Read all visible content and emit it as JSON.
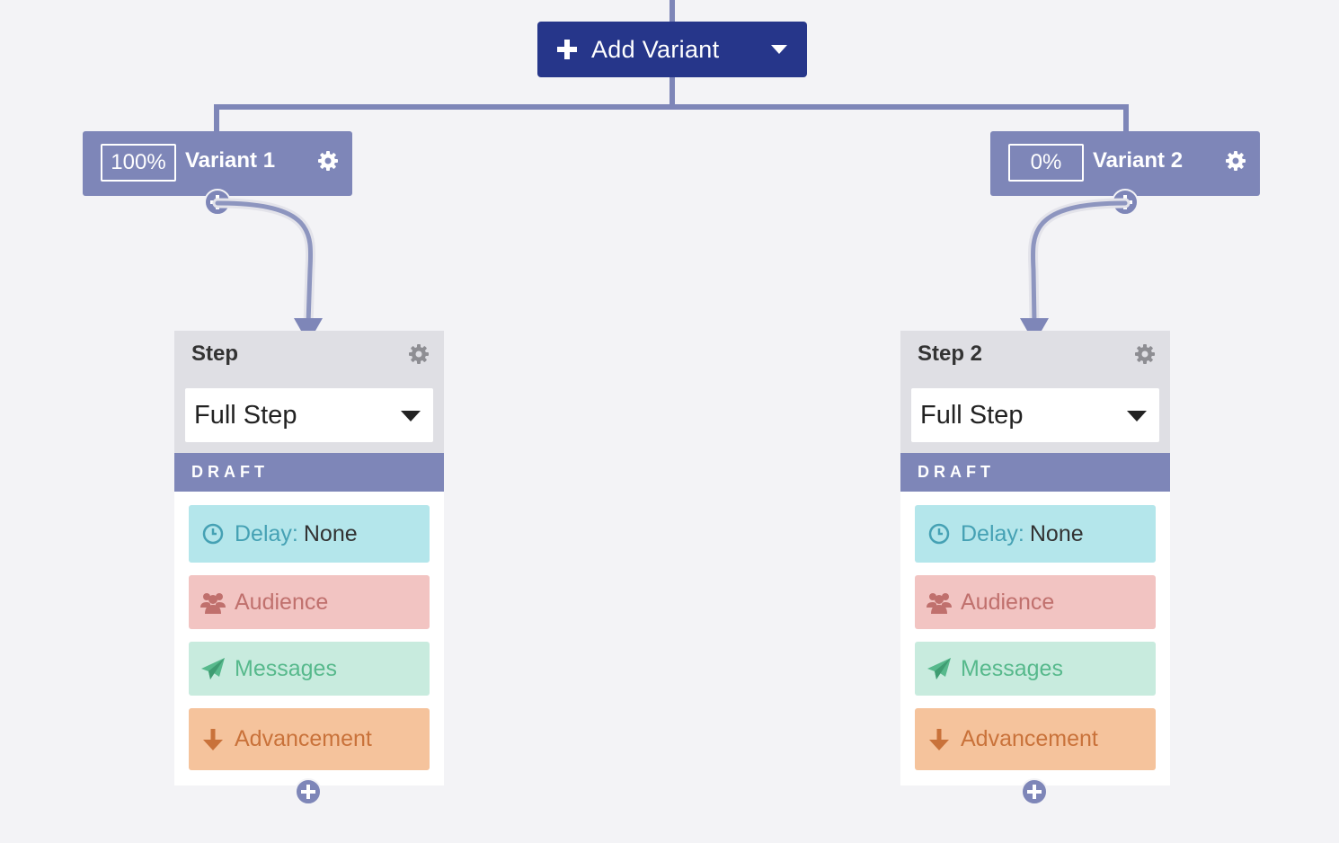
{
  "toolbar": {
    "add_variant_label": "Add Variant"
  },
  "variants": [
    {
      "percent": "100%",
      "name": "Variant 1"
    },
    {
      "percent": "0%",
      "name": "Variant 2"
    }
  ],
  "steps": [
    {
      "title": "Step",
      "type_selected": "Full Step",
      "status": "DRAFT",
      "delay_label": "Delay:",
      "delay_value": "None",
      "audience_label": "Audience",
      "messages_label": "Messages",
      "advancement_label": "Advancement"
    },
    {
      "title": "Step 2",
      "type_selected": "Full Step",
      "status": "DRAFT",
      "delay_label": "Delay:",
      "delay_value": "None",
      "audience_label": "Audience",
      "messages_label": "Messages",
      "advancement_label": "Advancement"
    }
  ],
  "colors": {
    "primary": "#26368a",
    "variant": "#7e86b8",
    "delay": "#b4e6eb",
    "audience": "#f2c4c2",
    "messages": "#c8ebde",
    "advancement": "#f5c39c"
  }
}
